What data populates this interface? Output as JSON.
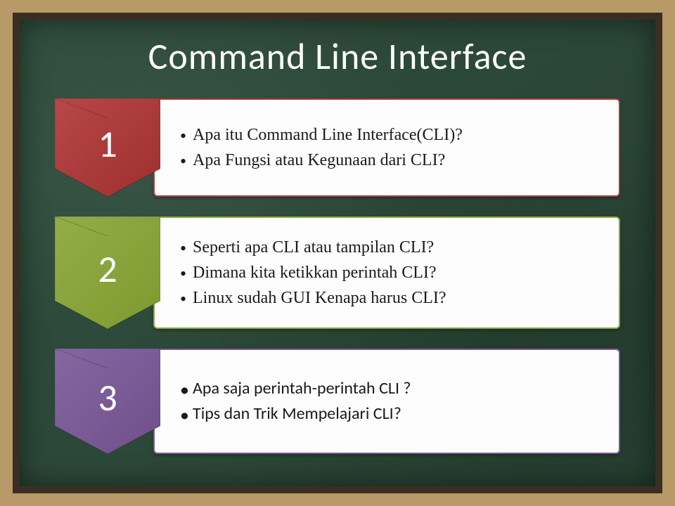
{
  "title": "Command Line Interface",
  "rows": [
    {
      "num": "1",
      "color": "#9e2f2f",
      "colorLight": "#b84848",
      "bullets": [
        "Apa itu Command Line Interface(CLI)?",
        "Apa Fungsi atau Kegunaan dari CLI?"
      ],
      "fontClass": "serif"
    },
    {
      "num": "2",
      "color": "#7d9a2e",
      "colorLight": "#93ad48",
      "bullets": [
        "Seperti apa CLI atau tampilan CLI?",
        "Dimana kita ketikkan perintah CLI?",
        "Linux sudah GUI Kenapa harus CLI?"
      ],
      "fontClass": "serif"
    },
    {
      "num": "3",
      "color": "#6f4f8a",
      "colorLight": "#8567a0",
      "bullets": [
        "Apa saja perintah-perintah CLI ?",
        "Tips dan Trik Mempelajari CLI?"
      ],
      "fontClass": ""
    }
  ]
}
